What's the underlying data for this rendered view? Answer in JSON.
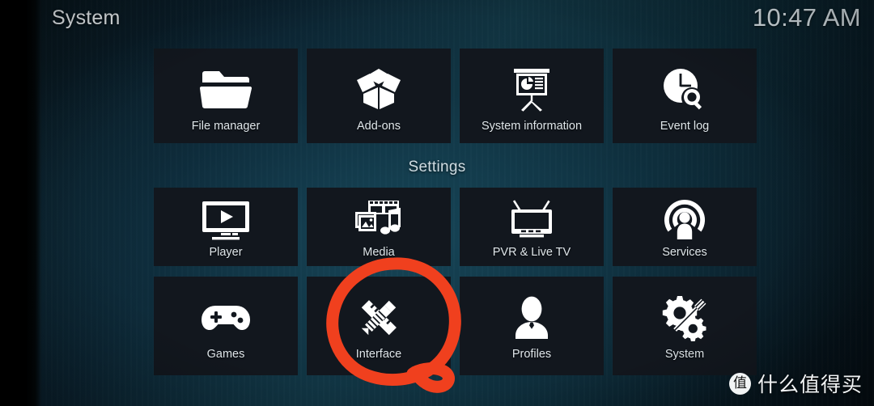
{
  "header": {
    "title": "System",
    "clock": "10:47 AM"
  },
  "sections": {
    "settings_label": "Settings"
  },
  "rows": {
    "top": [
      {
        "label": "File manager",
        "icon": "folder-icon"
      },
      {
        "label": "Add-ons",
        "icon": "open-box-icon"
      },
      {
        "label": "System information",
        "icon": "presentation-chart-icon"
      },
      {
        "label": "Event log",
        "icon": "clock-search-icon"
      }
    ],
    "middle": [
      {
        "label": "Player",
        "icon": "monitor-play-icon"
      },
      {
        "label": "Media",
        "icon": "media-photo-music-icon"
      },
      {
        "label": "PVR & Live TV",
        "icon": "television-antenna-icon"
      },
      {
        "label": "Services",
        "icon": "broadcast-person-icon"
      }
    ],
    "bottom": [
      {
        "label": "Games",
        "icon": "gamepad-icon"
      },
      {
        "label": "Interface",
        "icon": "pencil-ruler-icon"
      },
      {
        "label": "Profiles",
        "icon": "person-bust-icon"
      },
      {
        "label": "System",
        "icon": "gears-screwdriver-icon"
      }
    ]
  },
  "annotation": {
    "shape": "hand-drawn-circle",
    "target": "Interface",
    "color": "#F0401E"
  },
  "watermark": {
    "badge": "值",
    "text": "什么值得买"
  },
  "colors": {
    "tile_background": "#12171E",
    "label_text": "#DFE6EA",
    "annotation_red": "#F0401E"
  }
}
